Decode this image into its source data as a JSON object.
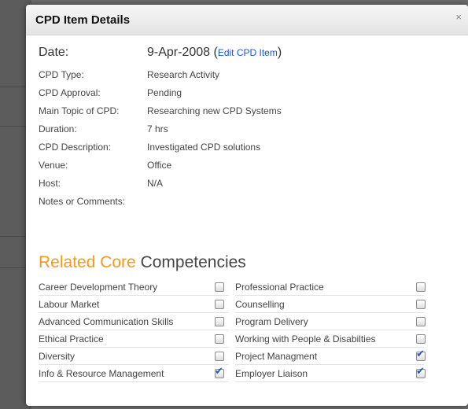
{
  "modal": {
    "title": "CPD Item Details",
    "close_label": "×"
  },
  "details": {
    "date_label": "Date:",
    "date_value": "9-Apr-2008",
    "edit_link": "Edit CPD Item",
    "rows": [
      {
        "label": "CPD Type:",
        "value": "Research Activity"
      },
      {
        "label": "CPD Approval:",
        "value": "Pending"
      },
      {
        "label": "Main Topic of CPD:",
        "value": "Researching new CPD Systems"
      },
      {
        "label": "Duration:",
        "value": "7 hrs"
      },
      {
        "label": "CPD Description:",
        "value": "Investigated CPD solutions"
      },
      {
        "label": "Venue:",
        "value": "Office"
      },
      {
        "label": "Host:",
        "value": "N/A"
      },
      {
        "label": "Notes or Comments:",
        "value": ""
      }
    ]
  },
  "competencies": {
    "heading_accent": "Related Core",
    "heading_rest": "Competencies",
    "rows": [
      {
        "left": "Career Development Theory",
        "left_checked": false,
        "right": "Professional Practice",
        "right_checked": false
      },
      {
        "left": "Labour Market",
        "left_checked": false,
        "right": "Counselling",
        "right_checked": false
      },
      {
        "left": "Advanced Communication Skills",
        "left_checked": false,
        "right": "Program Delivery",
        "right_checked": false
      },
      {
        "left": "Ethical Practice",
        "left_checked": false,
        "right": "Working with People & Disabilties",
        "right_checked": false
      },
      {
        "left": "Diversity",
        "left_checked": false,
        "right": "Project Managment",
        "right_checked": true
      },
      {
        "left": "Info & Resource Management",
        "left_checked": true,
        "right": "Employer Liaison",
        "right_checked": true
      }
    ]
  },
  "colors": {
    "accent": "#f39a1e",
    "link": "#1a55d6",
    "check": "#1f55c8"
  },
  "icons": {
    "close": "close-icon",
    "checkbox": "checkbox-icon"
  }
}
